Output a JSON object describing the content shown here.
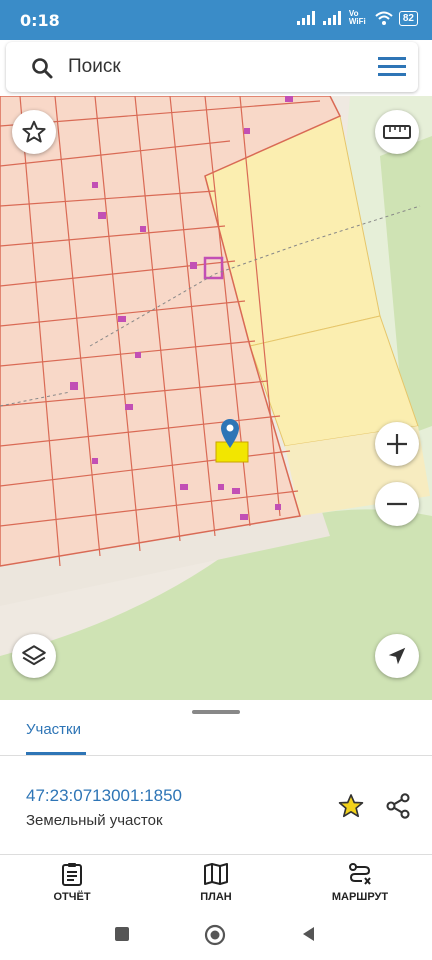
{
  "status_bar": {
    "time": "0:18",
    "network_label": "Vo WiFi",
    "battery": "82"
  },
  "search": {
    "placeholder": "Поиск"
  },
  "map": {
    "buttons": [
      "favorites",
      "ruler",
      "zoom-in",
      "zoom-out",
      "layers",
      "my-location"
    ],
    "colors": {
      "parcel_fill": "#f8d8c8",
      "parcel_stroke": "#d96a55",
      "field": "#fbeeb0",
      "forest": "#cfe3b4",
      "selected": "#f2e600",
      "marker": "#2e75b6"
    }
  },
  "sheet": {
    "tab_label": "Участки",
    "parcel": {
      "cadastral_number": "47:23:0713001:1850",
      "type": "Земельный участок"
    }
  },
  "bottom_nav": [
    {
      "label": "ОТЧЁТ",
      "icon": "report-icon"
    },
    {
      "label": "ПЛАН",
      "icon": "map-icon"
    },
    {
      "label": "МАРШРУТ",
      "icon": "route-icon"
    }
  ]
}
